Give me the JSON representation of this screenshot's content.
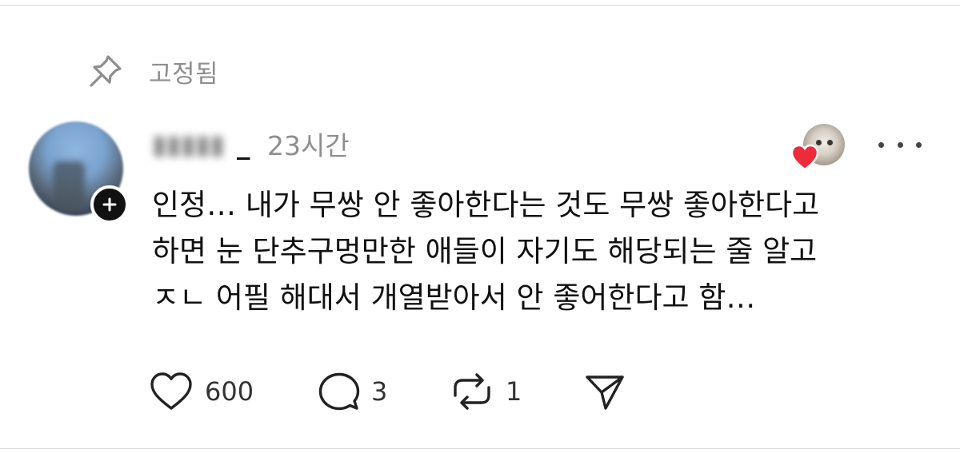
{
  "pinned": {
    "label": "고정됨",
    "icon": "pin-icon"
  },
  "post": {
    "author": {
      "username_visible_suffix": "_",
      "avatar_icon": "avatar"
    },
    "timestamp": "23시간",
    "body_lines": [
      "인정… 내가 무쌍 안 좋아한다는 것도 무쌍 좋아한다고",
      "하면 눈 단추구멍만한 애들이 자기도 해당되는 줄 알고",
      "ㅈㄴ 어필 해대서 개열받아서 안 좋어한다고 함…"
    ],
    "liked_by_author_badge": {
      "icon": "heart-icon",
      "color": "#ee2a3c"
    },
    "actions": {
      "like": {
        "icon": "heart-outline-icon",
        "count": "600"
      },
      "reply": {
        "icon": "speech-bubble-icon",
        "count": "3"
      },
      "repost": {
        "icon": "repost-icon",
        "count": "1"
      },
      "share": {
        "icon": "send-icon"
      }
    }
  },
  "colors": {
    "text_primary": "#111111",
    "text_secondary": "#8e8e8e",
    "heart_red": "#ee2a3c",
    "divider": "#d9d9d9"
  }
}
